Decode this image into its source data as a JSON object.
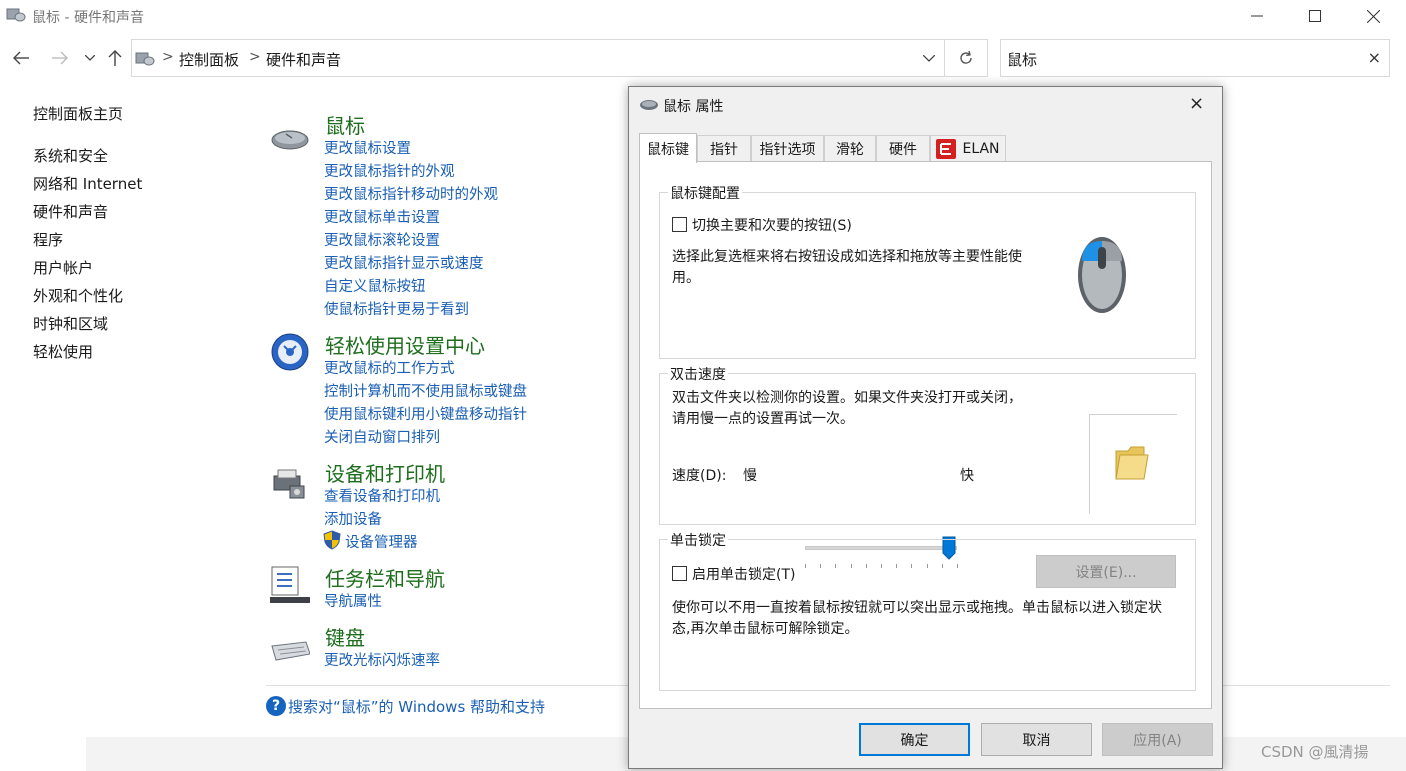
{
  "window": {
    "title": "鼠标 - 硬件和声音",
    "minimize_icon": "minimize-icon",
    "maximize_icon": "maximize-icon",
    "close_icon": "close-icon"
  },
  "nav": {
    "back_icon": "arrow-left-icon",
    "forward_icon": "arrow-right-icon",
    "recent_icon": "chevron-down-icon",
    "up_icon": "arrow-up-icon"
  },
  "address": {
    "crumbs": [
      "控制面板",
      "硬件和声音"
    ],
    "separator": ">"
  },
  "search": {
    "value": "鼠标",
    "clear": "×"
  },
  "sidebar": {
    "home": "控制面板主页",
    "items": [
      {
        "label": "系统和安全"
      },
      {
        "label": "网络和 Internet"
      },
      {
        "label": "硬件和声音"
      },
      {
        "label": "程序"
      },
      {
        "label": "用户帐户"
      },
      {
        "label": "外观和个性化"
      },
      {
        "label": "时钟和区域"
      },
      {
        "label": "轻松使用"
      }
    ]
  },
  "categories": [
    {
      "title": "鼠标",
      "icon": "mouse-icon",
      "links": [
        "更改鼠标设置",
        "更改鼠标指针的外观",
        "更改鼠标指针移动时的外观",
        "更改鼠标单击设置",
        "更改鼠标滚轮设置",
        "更改鼠标指针显示或速度",
        "自定义鼠标按钮",
        "使鼠标指针更易于看到"
      ]
    },
    {
      "title": "轻松使用设置中心",
      "icon": "ease-of-access-icon",
      "links": [
        "更改鼠标的工作方式",
        "控制计算机而不使用鼠标或键盘",
        "使用鼠标键利用小键盘移动指针",
        "关闭自动窗口排列"
      ]
    },
    {
      "title": "设备和打印机",
      "icon": "printer-icon",
      "links": [
        "查看设备和打印机",
        "添加设备",
        "设备管理器"
      ]
    },
    {
      "title": "任务栏和导航",
      "icon": "taskbar-icon",
      "links": [
        "导航属性"
      ]
    },
    {
      "title": "键盘",
      "icon": "keyboard-icon",
      "links": [
        "更改光标闪烁速率"
      ]
    }
  ],
  "help": {
    "icon": "?",
    "text": "搜索对“鼠标”的 Windows 帮助和支持"
  },
  "dialog": {
    "title": "鼠标 属性",
    "close": "×",
    "tabs": [
      "鼠标键",
      "指针",
      "指针选项",
      "滑轮",
      "硬件",
      "ELAN"
    ],
    "active_tab": "鼠标键",
    "button_config": {
      "label": "鼠标键配置",
      "checkbox_label": "切换主要和次要的按钮(S)",
      "checked": false,
      "description": "选择此复选框来将右按钮设成如选择和拖放等主要性能使用。"
    },
    "double_click": {
      "label": "双击速度",
      "description": "双击文件夹以检测你的设置。如果文件夹没打开或关闭，请用慢一点的设置再试一次。",
      "speed_label": "速度(D):",
      "slow": "慢",
      "fast": "快",
      "speed_fraction": 0.95
    },
    "click_lock": {
      "label": "单击锁定",
      "checkbox_label": "启用单击锁定(T)",
      "checked": false,
      "settings_button": "设置(E)...",
      "description": "使你可以不用一直按着鼠标按钮就可以突出显示或拖拽。单击鼠标以进入锁定状态,再次单击鼠标可解除锁定。"
    },
    "buttons": {
      "ok": "确定",
      "cancel": "取消",
      "apply": "应用(A)"
    }
  },
  "watermark": "CSDN @風清揚",
  "colors": {
    "category_title": "#1e6e1e",
    "link": "#1a5fb4",
    "accent": "#0078d7"
  }
}
